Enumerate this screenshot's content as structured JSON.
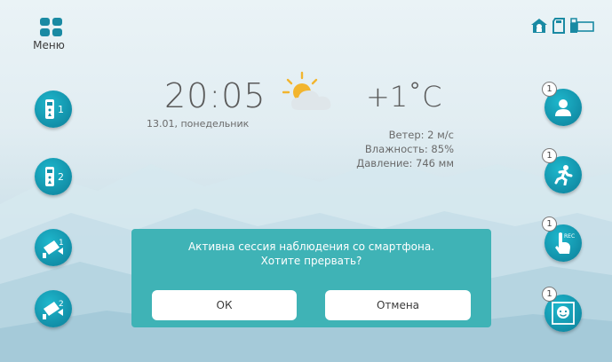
{
  "menu": {
    "label": "Меню",
    "icon": "grid-icon"
  },
  "status_icons": [
    "home-lock-icon",
    "sd-card-icon",
    "usb-icon"
  ],
  "clock": {
    "time": "20:05",
    "date": "13.01, понедельник"
  },
  "weather": {
    "icon": "partly-cloudy-icon",
    "temperature": "+1˚C",
    "wind": "Ветер: 2 м/с",
    "humidity": "Влажность: 85%",
    "pressure": "Давление: 746 мм"
  },
  "left_buttons": [
    {
      "name": "doorphone-1",
      "icon": "doorphone-icon",
      "label": "1"
    },
    {
      "name": "doorphone-2",
      "icon": "doorphone-icon",
      "label": "2"
    },
    {
      "name": "camera-1",
      "icon": "cctv-camera-icon",
      "label": "1"
    },
    {
      "name": "camera-2",
      "icon": "cctv-camera-icon",
      "label": "2"
    }
  ],
  "right_buttons": [
    {
      "name": "visitor",
      "icon": "person-icon",
      "badge": "1"
    },
    {
      "name": "motion",
      "icon": "running-man-icon",
      "badge": "1"
    },
    {
      "name": "record",
      "icon": "touch-rec-icon",
      "badge": "1",
      "sub": "REC"
    },
    {
      "name": "face",
      "icon": "face-frame-icon",
      "badge": "1"
    }
  ],
  "dialog": {
    "line1": "Активна сессия наблюдения со смартфона.",
    "line2": "Хотите прервать?",
    "ok_label": "ОК",
    "cancel_label": "Отмена"
  },
  "colors": {
    "accent": "#1a8aa3",
    "dialog": "#3fb3b6",
    "button_gradient": "#1eb7cc"
  }
}
